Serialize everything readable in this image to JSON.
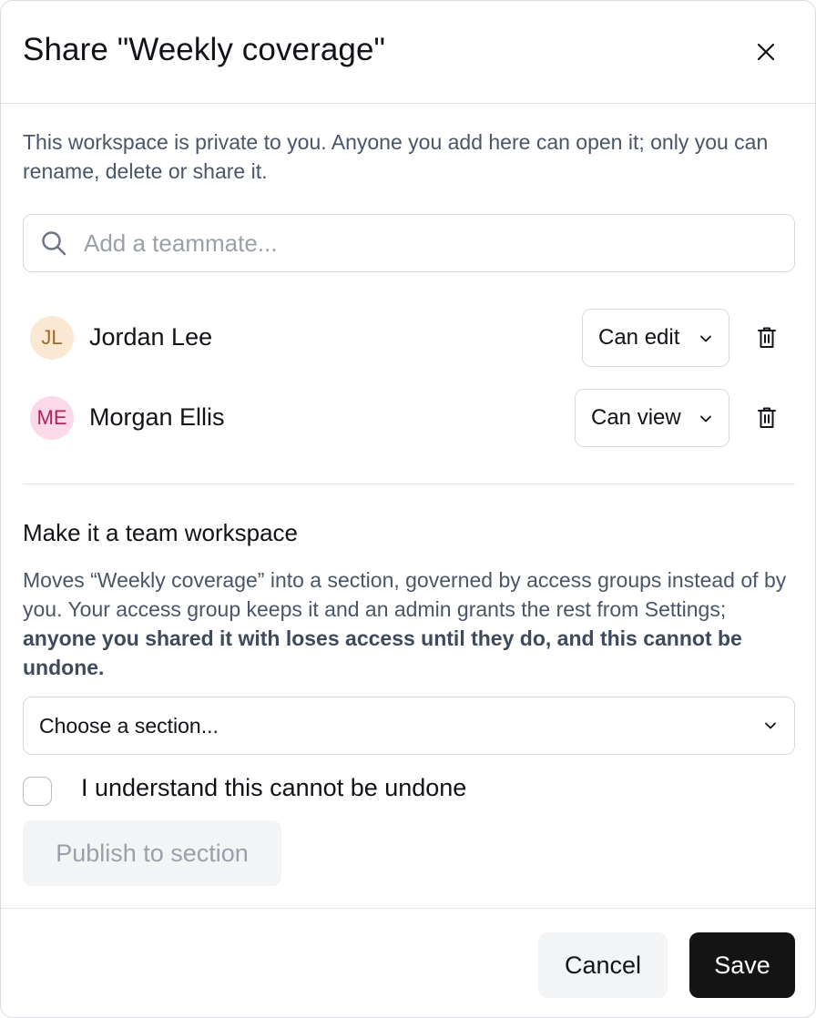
{
  "dialog": {
    "title": "Share \"Weekly coverage\"",
    "close_icon": "close-icon",
    "intro": "This workspace is private to you. Anyone you add here can open it; only you can rename, delete or share it."
  },
  "search": {
    "icon": "search-icon",
    "placeholder": "Add a teammate..."
  },
  "members": [
    {
      "initials": "JL",
      "name": "Jordan Lee",
      "role": "Can edit",
      "avatar_bg": "#fbe8d3",
      "avatar_fg": "#a0692c"
    },
    {
      "initials": "ME",
      "name": "Morgan Ellis",
      "role": "Can view",
      "avatar_bg": "#fbd9e8",
      "avatar_fg": "#b0245e"
    }
  ],
  "team": {
    "title": "Make it a team workspace",
    "desc_plain": "Moves “Weekly coverage” into a section, governed by access groups instead of by you. Your access group keeps it and an admin grants the rest from Settings; ",
    "desc_bold": "anyone you shared it with loses access until they do, and this cannot be undone.",
    "section_placeholder": "Choose a section...",
    "confirm_label": "I understand this cannot be undone",
    "confirm_checked": false,
    "publish_label": "Publish to section",
    "publish_enabled": false
  },
  "footer": {
    "cancel_label": "Cancel",
    "save_label": "Save"
  },
  "colors": {
    "primary_button": "#141414",
    "muted_text": "#4a5568",
    "border": "#d6d9de"
  }
}
